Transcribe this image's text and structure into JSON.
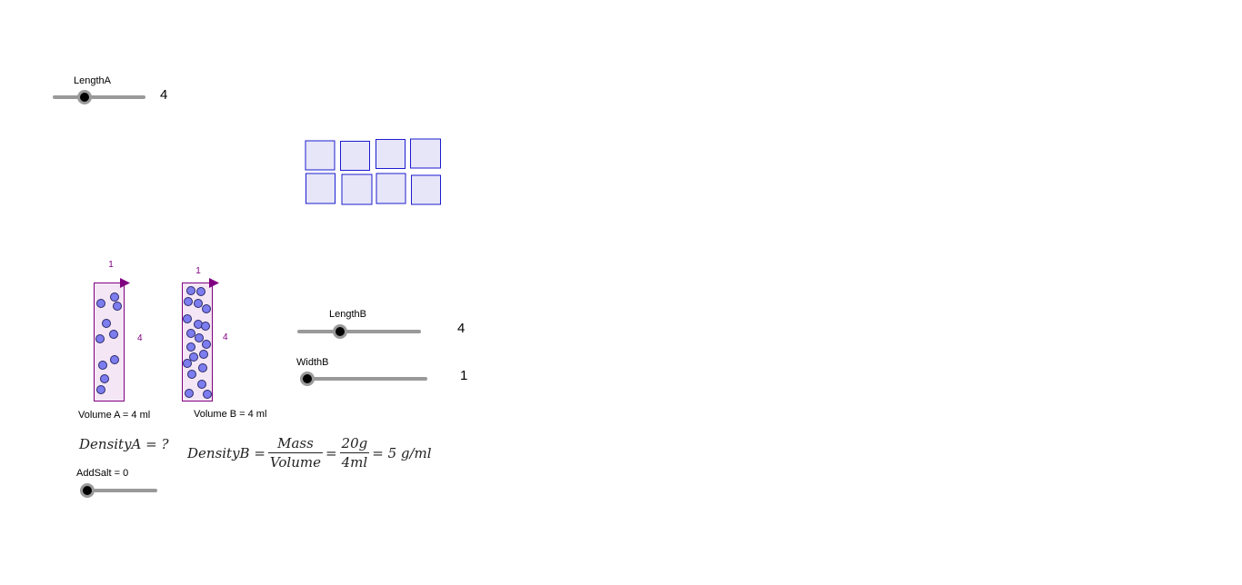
{
  "sliders": {
    "length_a": {
      "label": "LengthA",
      "value": "4",
      "fraction": 0.333
    },
    "length_b": {
      "label": "LengthB",
      "value": "4",
      "fraction": 0.333
    },
    "width_b": {
      "label": "WidthB",
      "value": "1",
      "fraction": 0.0
    },
    "add_salt": {
      "label": "AddSalt = 0",
      "fraction": 0.0
    }
  },
  "containers": {
    "a": {
      "top_label": "1",
      "side_label": "4",
      "volume_label": "Volume A = 4 ml"
    },
    "b": {
      "top_label": "1",
      "side_label": "4",
      "volume_label": "Volume B = 4 ml"
    }
  },
  "density_a": {
    "text": "DensityA = ?"
  },
  "density_b": {
    "lhs": "DensityB =",
    "num1": "Mass",
    "den1": "Volume",
    "eq1": "=",
    "num2": "20g",
    "den2": "4ml",
    "rhs": "= 5 g/ml"
  },
  "colors": {
    "square_fill": "#e6e6f8",
    "square_stroke": "#1c1cd0",
    "container_fill": "#f4e6f4",
    "container_stroke": "#800080",
    "particle_fill": "#7d7df0",
    "particle_stroke": "#2a2a6a",
    "slider_track": "#999999"
  }
}
